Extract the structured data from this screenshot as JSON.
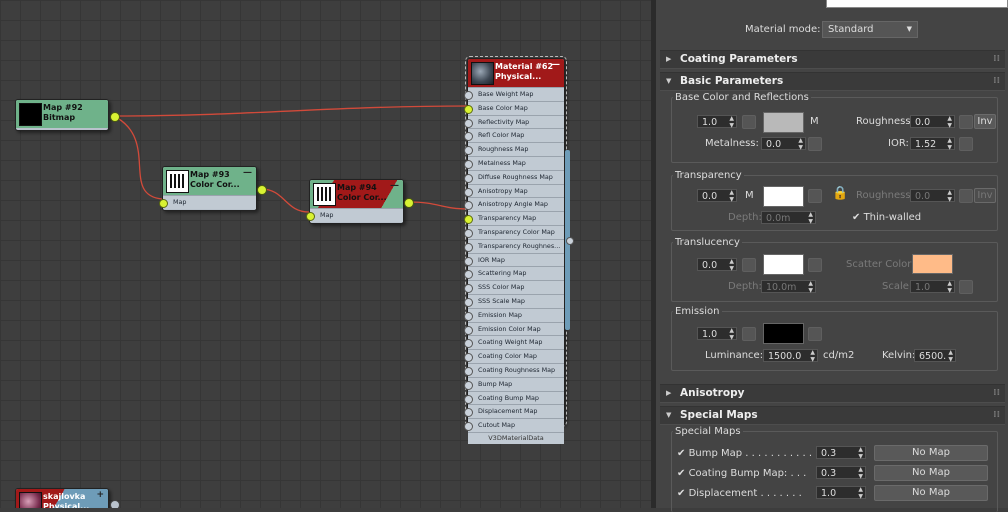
{
  "nodes": {
    "map92": {
      "title": "Map #92",
      "type": "Bitmap"
    },
    "map93": {
      "title": "Map #93",
      "type": "Color Cor...",
      "slot": "Map"
    },
    "map94": {
      "title": "Map #94",
      "type": "Color Cor...",
      "slot": "Map"
    },
    "material62": {
      "title": "Material #62",
      "type": "Physical...",
      "slots": [
        "Base Weight Map",
        "Base Color Map",
        "Reflectivity Map",
        "Refl Color Map",
        "Roughness Map",
        "Metalness Map",
        "Diffuse Roughness Map",
        "Anisotropy Map",
        "Anisotropy Angle Map",
        "Transparency Map",
        "Transparency Color Map",
        "Transparency Roughnes...",
        "IOR Map",
        "Scattering Map",
        "SSS Color Map",
        "SSS Scale Map",
        "Emission Map",
        "Emission Color Map",
        "Coating Weight Map",
        "Coating Color Map",
        "Coating Roughness Map",
        "Bump Map",
        "Coating Bump Map",
        "Displacement Map",
        "Cutout Map"
      ],
      "footer": "V3DMaterialData"
    },
    "skajlovka": {
      "title": "skajlovka",
      "type": "Physical..."
    }
  },
  "panel": {
    "material_mode_label": "Material mode:",
    "material_mode_value": "Standard",
    "rollouts": {
      "coating": "Coating Parameters",
      "basic": "Basic Parameters",
      "anisotropy": "Anisotropy",
      "special": "Special Maps"
    },
    "base": {
      "group": "Base Color and Reflections",
      "weight": "1.0",
      "m": "M",
      "roughness_label": "Roughness:",
      "roughness": "0.0",
      "inv": "Inv",
      "metalness_label": "Metalness:",
      "metalness": "0.0",
      "ior_label": "IOR:",
      "ior": "1.52",
      "color": "#b9b9b9"
    },
    "transparency": {
      "group": "Transparency",
      "weight": "0.0",
      "m": "M",
      "roughness_label": "Roughness:",
      "roughness": "0.0",
      "inv": "Inv",
      "depth_label": "Depth:",
      "depth": "0.0m",
      "thin_walled": "Thin-walled",
      "color": "#ffffff"
    },
    "translucency": {
      "group": "Translucency",
      "weight": "0.0",
      "scatter_label": "Scatter Color:",
      "depth_label": "Depth:",
      "depth": "10.0m",
      "scale_label": "Scale:",
      "scale": "1.0",
      "color": "#ffffff",
      "scatter_color": "#ffbb88"
    },
    "emission": {
      "group": "Emission",
      "weight": "1.0",
      "luminance_label": "Luminance:",
      "luminance": "1500.0",
      "unit": "cd/m2",
      "kelvin_label": "Kelvin:",
      "kelvin": "6500.",
      "color": "#000000"
    },
    "special": {
      "group": "Special Maps",
      "rows": [
        {
          "label": "Bump Map . . . . . . . . . . .",
          "value": "0.3",
          "button": "No Map"
        },
        {
          "label": "Coating Bump Map: . . .",
          "value": "0.3",
          "button": "No Map"
        },
        {
          "label": "Displacement . . . . . . .",
          "value": "1.0",
          "button": "No Map"
        }
      ]
    }
  }
}
